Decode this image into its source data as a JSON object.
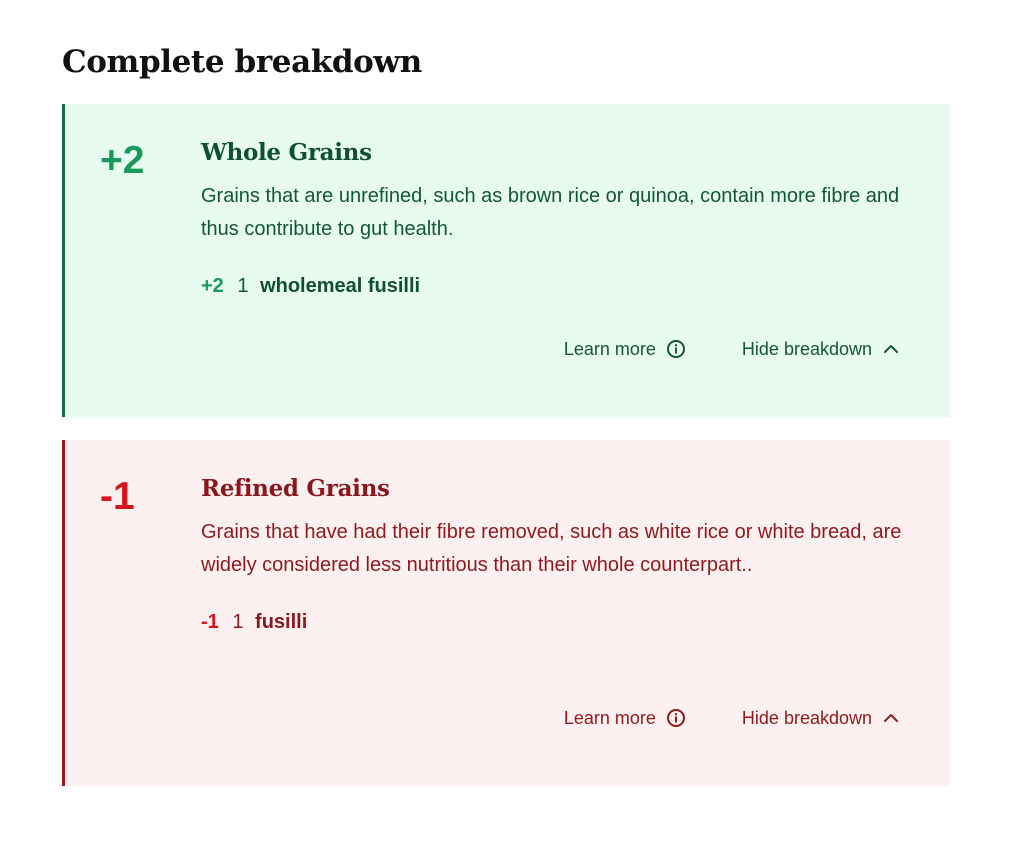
{
  "page": {
    "title": "Complete breakdown"
  },
  "cards": [
    {
      "score": "+2",
      "title": "Whole Grains",
      "description": "Grains that are unrefined, such as brown rice or quinoa, contain more fibre and thus contribute to gut health.",
      "item": {
        "points": "+2",
        "quantity": "1",
        "name": "wholemeal fusilli"
      },
      "learn_more_label": "Learn more",
      "hide_label": "Hide breakdown",
      "colors": {
        "background": "#e8fbf0",
        "accent": "#1a9a5a",
        "text": "#13563a"
      }
    },
    {
      "score": "-1",
      "title": "Refined Grains",
      "description": "Grains that have had their fibre removed, such as white rice or white bread, are widely considered less nutritious than their whole counterpart..",
      "item": {
        "points": "-1",
        "quantity": "1",
        "name": "fusilli"
      },
      "learn_more_label": "Learn more",
      "hide_label": "Hide breakdown",
      "colors": {
        "background": "#fcf0f0",
        "accent": "#d6141c",
        "text": "#8f1a1e"
      }
    }
  ],
  "icons": {
    "learn_more": "info-circle-icon",
    "hide": "chevron-up-icon"
  }
}
